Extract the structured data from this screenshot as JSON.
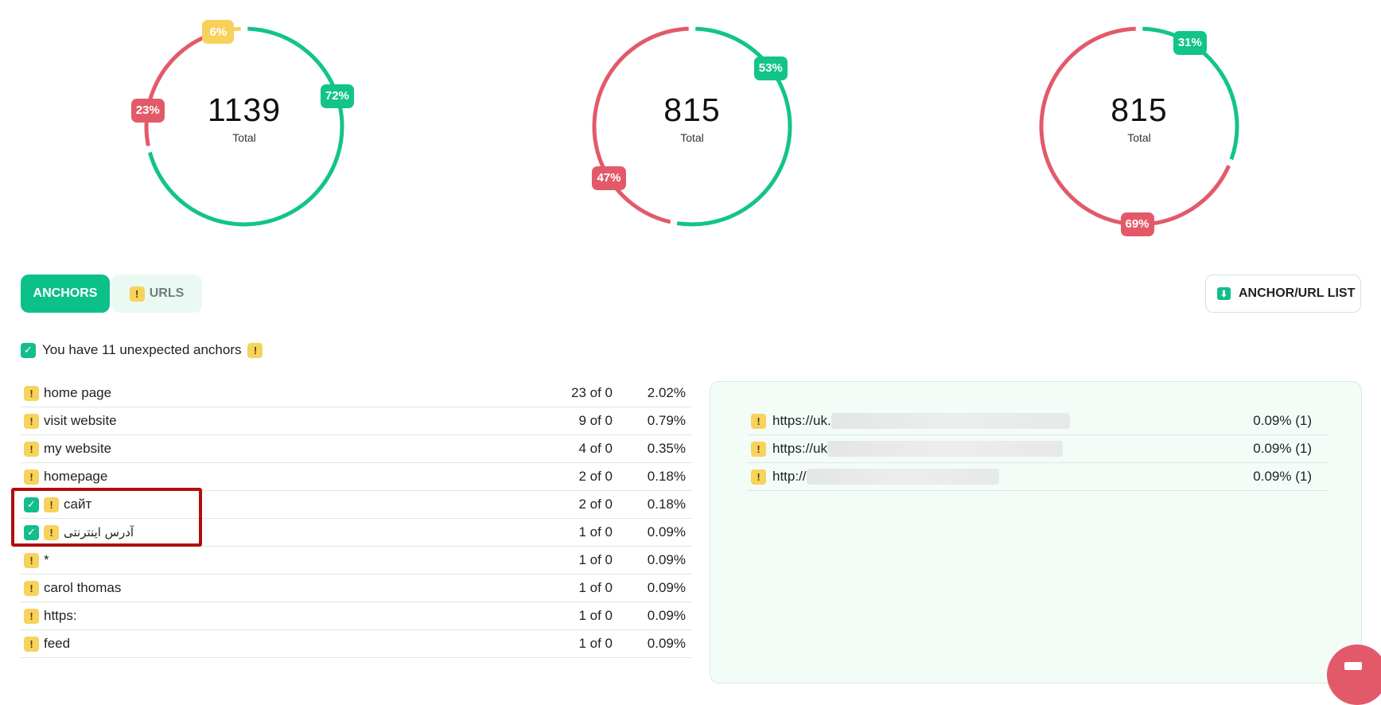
{
  "colors": {
    "green": "#0cc08a",
    "red": "#e25a6a",
    "yellow": "#f7d35c"
  },
  "charts": [
    {
      "total": "1139",
      "total_label": "Total",
      "segments": [
        {
          "name": "green",
          "percent": 72,
          "label": "72%",
          "color": "#12c488"
        },
        {
          "name": "red",
          "percent": 23,
          "label": "23%",
          "color": "#e25a6a"
        },
        {
          "name": "yellow",
          "percent": 6,
          "label": "6%",
          "color": "#f8d15b"
        }
      ]
    },
    {
      "total": "815",
      "total_label": "Total",
      "segments": [
        {
          "name": "green",
          "percent": 53,
          "label": "53%",
          "color": "#12c488"
        },
        {
          "name": "red",
          "percent": 47,
          "label": "47%",
          "color": "#e25a6a"
        }
      ]
    },
    {
      "total": "815",
      "total_label": "Total",
      "segments": [
        {
          "name": "green",
          "percent": 31,
          "label": "31%",
          "color": "#12c488"
        },
        {
          "name": "red",
          "percent": 69,
          "label": "69%",
          "color": "#e25a6a"
        }
      ]
    }
  ],
  "tabs": {
    "anchors": "ANCHORS",
    "urls": "URLS"
  },
  "list_button": "ANCHOR/URL LIST",
  "summary": {
    "text": "You have 11 unexpected anchors"
  },
  "anchors": [
    {
      "label": "home page",
      "count": "23 of 0",
      "pct": "2.02%",
      "checked": false
    },
    {
      "label": "visit website",
      "count": "9 of 0",
      "pct": "0.79%",
      "checked": false
    },
    {
      "label": "my website",
      "count": "4 of 0",
      "pct": "0.35%",
      "checked": false
    },
    {
      "label": "homepage",
      "count": "2 of 0",
      "pct": "0.18%",
      "checked": false
    },
    {
      "label": "сайт",
      "count": "2 of 0",
      "pct": "0.18%",
      "checked": true
    },
    {
      "label": "آدرس اینترنتی",
      "count": "1 of 0",
      "pct": "0.09%",
      "checked": true
    },
    {
      "label": "*",
      "count": "1 of 0",
      "pct": "0.09%",
      "checked": false
    },
    {
      "label": "carol thomas",
      "count": "1 of 0",
      "pct": "0.09%",
      "checked": false
    },
    {
      "label": "https:",
      "count": "1 of 0",
      "pct": "0.09%",
      "checked": false
    },
    {
      "label": "feed",
      "count": "1 of 0",
      "pct": "0.09%",
      "checked": false
    }
  ],
  "urls": [
    {
      "prefix": "https://uk.",
      "value": "0.09% (1)"
    },
    {
      "prefix": "https://uk",
      "value": "0.09% (1)"
    },
    {
      "prefix": "http://",
      "value": "0.09% (1)"
    }
  ]
}
